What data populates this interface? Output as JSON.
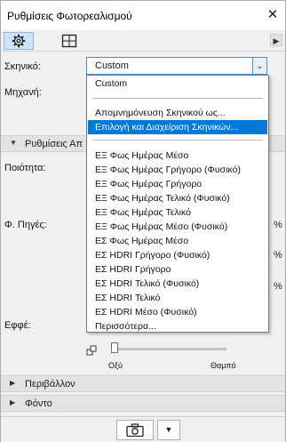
{
  "window": {
    "title": "Ρυθμίσεις Φωτορεαλισμού",
    "close_glyph": "✕"
  },
  "toolbar": {
    "tabs": [
      {
        "icon": "gear-icon",
        "active": true
      },
      {
        "icon": "frame-icon",
        "active": false
      }
    ],
    "more_glyph": "▶"
  },
  "fields": {
    "scene_label": "Σκηνικό:",
    "scene_value": "Custom",
    "engine_label": "Μηχανή:",
    "quality_label": "Ποιότητα:",
    "light_sources_label": "Φ. Πηγές:",
    "effects_label": "Εφφέ:"
  },
  "sections": {
    "settings_header": "Ρυθμίσεις Απ",
    "environment": "Περιβάλλον",
    "background": "Φόντο"
  },
  "side_pcts": [
    "%",
    "%",
    "%"
  ],
  "slider": {
    "left_label": "Οξύ",
    "right_label": "Θαμπό",
    "value": 0.0
  },
  "dropdown": {
    "group1": [
      "Custom"
    ],
    "group2": [
      "Απομνημόνευση Σκηνικού ως...",
      "Επιλογή και Διαχείριση Σκηνικών..."
    ],
    "selected": "Επιλογή και Διαχείριση Σκηνικών...",
    "group3": [
      "ΕΞ Φως Ημέρας Μέσο",
      "ΕΞ Φως Ημέρας Γρήγορο (Φυσικό)",
      "ΕΞ Φως Ημέρας Γρήγορο",
      "ΕΞ Φως Ημέρας Τελικό (Φυσικό)",
      "ΕΞ Φως Ημέρας Τελικό",
      "ΕΞ Φως Ημέρας Μέσο (Φυσικό)",
      "ΕΣ Φως Ημέρας Μέσο",
      "ΕΣ HDRI Γρήγορο (Φυσικό)",
      "ΕΣ HDRI Γρήγορο",
      "ΕΣ HDRI Τελικό (Φυσικό)",
      "ΕΣ HDRI Τελικό",
      "ΕΣ HDRI Μέσο (Φυσικό)",
      "Περισσότερα..."
    ]
  },
  "footer": {
    "render_icon": "camera-icon",
    "menu_glyph": "▼"
  }
}
